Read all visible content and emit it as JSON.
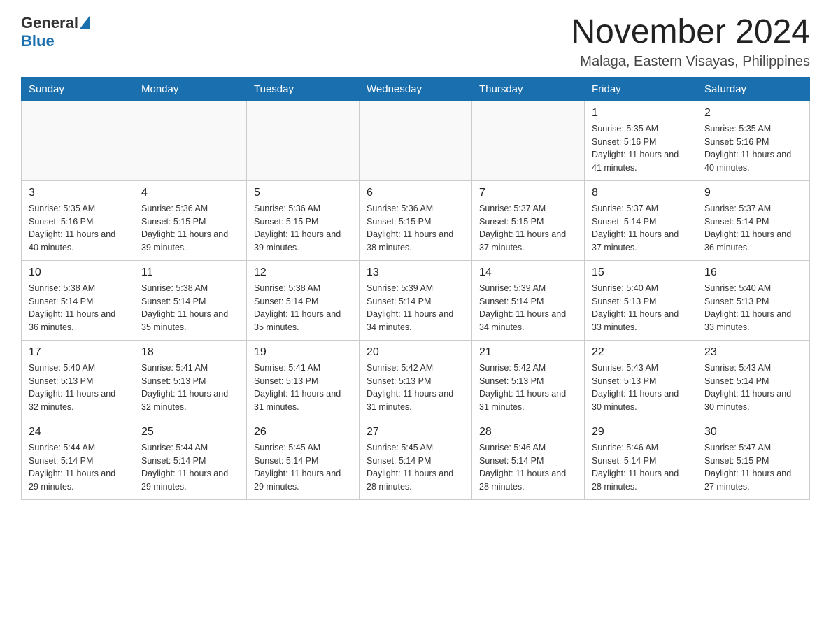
{
  "logo": {
    "general": "General",
    "blue": "Blue"
  },
  "title": "November 2024",
  "subtitle": "Malaga, Eastern Visayas, Philippines",
  "headers": [
    "Sunday",
    "Monday",
    "Tuesday",
    "Wednesday",
    "Thursday",
    "Friday",
    "Saturday"
  ],
  "weeks": [
    [
      {
        "day": "",
        "info": ""
      },
      {
        "day": "",
        "info": ""
      },
      {
        "day": "",
        "info": ""
      },
      {
        "day": "",
        "info": ""
      },
      {
        "day": "",
        "info": ""
      },
      {
        "day": "1",
        "info": "Sunrise: 5:35 AM\nSunset: 5:16 PM\nDaylight: 11 hours and 41 minutes."
      },
      {
        "day": "2",
        "info": "Sunrise: 5:35 AM\nSunset: 5:16 PM\nDaylight: 11 hours and 40 minutes."
      }
    ],
    [
      {
        "day": "3",
        "info": "Sunrise: 5:35 AM\nSunset: 5:16 PM\nDaylight: 11 hours and 40 minutes."
      },
      {
        "day": "4",
        "info": "Sunrise: 5:36 AM\nSunset: 5:15 PM\nDaylight: 11 hours and 39 minutes."
      },
      {
        "day": "5",
        "info": "Sunrise: 5:36 AM\nSunset: 5:15 PM\nDaylight: 11 hours and 39 minutes."
      },
      {
        "day": "6",
        "info": "Sunrise: 5:36 AM\nSunset: 5:15 PM\nDaylight: 11 hours and 38 minutes."
      },
      {
        "day": "7",
        "info": "Sunrise: 5:37 AM\nSunset: 5:15 PM\nDaylight: 11 hours and 37 minutes."
      },
      {
        "day": "8",
        "info": "Sunrise: 5:37 AM\nSunset: 5:14 PM\nDaylight: 11 hours and 37 minutes."
      },
      {
        "day": "9",
        "info": "Sunrise: 5:37 AM\nSunset: 5:14 PM\nDaylight: 11 hours and 36 minutes."
      }
    ],
    [
      {
        "day": "10",
        "info": "Sunrise: 5:38 AM\nSunset: 5:14 PM\nDaylight: 11 hours and 36 minutes."
      },
      {
        "day": "11",
        "info": "Sunrise: 5:38 AM\nSunset: 5:14 PM\nDaylight: 11 hours and 35 minutes."
      },
      {
        "day": "12",
        "info": "Sunrise: 5:38 AM\nSunset: 5:14 PM\nDaylight: 11 hours and 35 minutes."
      },
      {
        "day": "13",
        "info": "Sunrise: 5:39 AM\nSunset: 5:14 PM\nDaylight: 11 hours and 34 minutes."
      },
      {
        "day": "14",
        "info": "Sunrise: 5:39 AM\nSunset: 5:14 PM\nDaylight: 11 hours and 34 minutes."
      },
      {
        "day": "15",
        "info": "Sunrise: 5:40 AM\nSunset: 5:13 PM\nDaylight: 11 hours and 33 minutes."
      },
      {
        "day": "16",
        "info": "Sunrise: 5:40 AM\nSunset: 5:13 PM\nDaylight: 11 hours and 33 minutes."
      }
    ],
    [
      {
        "day": "17",
        "info": "Sunrise: 5:40 AM\nSunset: 5:13 PM\nDaylight: 11 hours and 32 minutes."
      },
      {
        "day": "18",
        "info": "Sunrise: 5:41 AM\nSunset: 5:13 PM\nDaylight: 11 hours and 32 minutes."
      },
      {
        "day": "19",
        "info": "Sunrise: 5:41 AM\nSunset: 5:13 PM\nDaylight: 11 hours and 31 minutes."
      },
      {
        "day": "20",
        "info": "Sunrise: 5:42 AM\nSunset: 5:13 PM\nDaylight: 11 hours and 31 minutes."
      },
      {
        "day": "21",
        "info": "Sunrise: 5:42 AM\nSunset: 5:13 PM\nDaylight: 11 hours and 31 minutes."
      },
      {
        "day": "22",
        "info": "Sunrise: 5:43 AM\nSunset: 5:13 PM\nDaylight: 11 hours and 30 minutes."
      },
      {
        "day": "23",
        "info": "Sunrise: 5:43 AM\nSunset: 5:14 PM\nDaylight: 11 hours and 30 minutes."
      }
    ],
    [
      {
        "day": "24",
        "info": "Sunrise: 5:44 AM\nSunset: 5:14 PM\nDaylight: 11 hours and 29 minutes."
      },
      {
        "day": "25",
        "info": "Sunrise: 5:44 AM\nSunset: 5:14 PM\nDaylight: 11 hours and 29 minutes."
      },
      {
        "day": "26",
        "info": "Sunrise: 5:45 AM\nSunset: 5:14 PM\nDaylight: 11 hours and 29 minutes."
      },
      {
        "day": "27",
        "info": "Sunrise: 5:45 AM\nSunset: 5:14 PM\nDaylight: 11 hours and 28 minutes."
      },
      {
        "day": "28",
        "info": "Sunrise: 5:46 AM\nSunset: 5:14 PM\nDaylight: 11 hours and 28 minutes."
      },
      {
        "day": "29",
        "info": "Sunrise: 5:46 AM\nSunset: 5:14 PM\nDaylight: 11 hours and 28 minutes."
      },
      {
        "day": "30",
        "info": "Sunrise: 5:47 AM\nSunset: 5:15 PM\nDaylight: 11 hours and 27 minutes."
      }
    ]
  ]
}
